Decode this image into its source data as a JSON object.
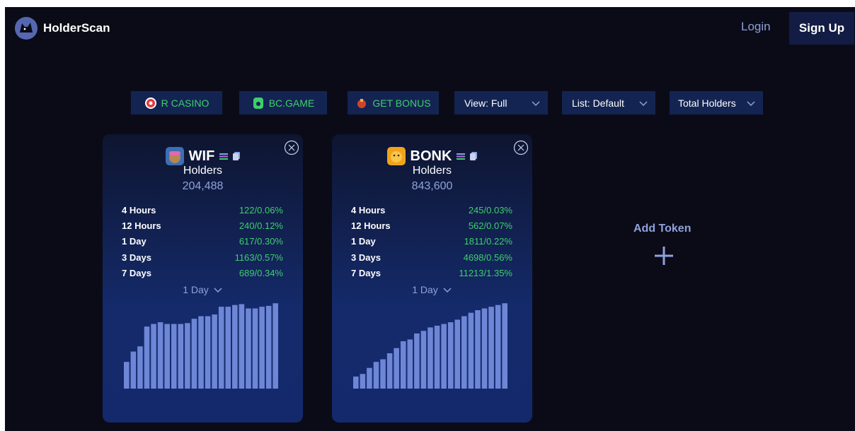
{
  "header": {
    "brand": "HolderScan",
    "login_label": "Login",
    "signup_label": "Sign Up"
  },
  "toolbar": {
    "promos": [
      {
        "label": "R CASINO",
        "icon": "casino-icon"
      },
      {
        "label": "BC.GAME",
        "icon": "bcgame-icon"
      },
      {
        "label": "GET BONUS",
        "icon": "bonus-icon"
      }
    ],
    "view_label": "View: Full",
    "list_label": "List: Default",
    "sort_label": "Total Holders"
  },
  "cards": [
    {
      "ticker": "WIF",
      "holders_label": "Holders",
      "holders_value": "204,488",
      "stats": [
        {
          "label": "4 Hours",
          "value": "122/0.06%"
        },
        {
          "label": "12 Hours",
          "value": "240/0.12%"
        },
        {
          "label": "1 Day",
          "value": "617/0.30%"
        },
        {
          "label": "3 Days",
          "value": "1163/0.57%"
        },
        {
          "label": "7 Days",
          "value": "689/0.34%"
        }
      ],
      "period_label": "1 Day",
      "bars": [
        0.31,
        0.43,
        0.49,
        0.72,
        0.75,
        0.77,
        0.75,
        0.75,
        0.75,
        0.76,
        0.81,
        0.84,
        0.84,
        0.86,
        0.95,
        0.95,
        0.97,
        0.98,
        0.93,
        0.93,
        0.95,
        0.96,
        0.99
      ]
    },
    {
      "ticker": "BONK",
      "holders_label": "Holders",
      "holders_value": "843,600",
      "stats": [
        {
          "label": "4 Hours",
          "value": "245/0.03%"
        },
        {
          "label": "12 Hours",
          "value": "562/0.07%"
        },
        {
          "label": "1 Day",
          "value": "1811/0.22%"
        },
        {
          "label": "3 Days",
          "value": "4698/0.56%"
        },
        {
          "label": "7 Days",
          "value": "11213/1.35%"
        }
      ],
      "period_label": "1 Day",
      "bars": [
        0.14,
        0.17,
        0.24,
        0.31,
        0.34,
        0.41,
        0.47,
        0.55,
        0.57,
        0.64,
        0.67,
        0.71,
        0.73,
        0.75,
        0.77,
        0.8,
        0.84,
        0.88,
        0.91,
        0.93,
        0.95,
        0.97,
        0.99
      ]
    }
  ],
  "add_token_label": "Add Token",
  "colors": {
    "background": "#0b0b18",
    "card": "#142a6a",
    "positive": "#3ecf6b",
    "accent": "#8ea2db",
    "bar": "#6e86d6"
  }
}
